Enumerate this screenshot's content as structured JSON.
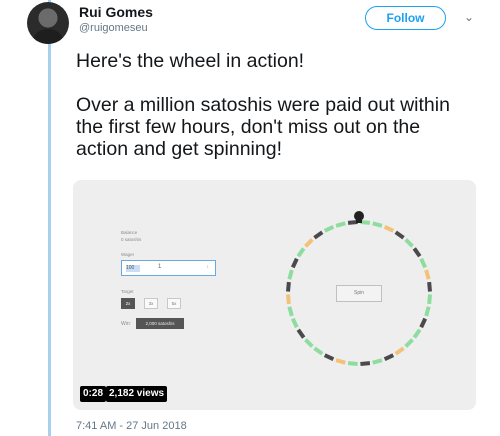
{
  "author": {
    "name": "Rui Gomes",
    "handle": "@ruigomeseu"
  },
  "follow_label": "Follow",
  "menu_icon": "chevron-down-icon",
  "tweet": {
    "paragraph_1": "Here's the wheel in action!",
    "paragraph_2": "Over a million satoshis were paid out within the first few hours, don't miss out on the action and get spinning!"
  },
  "video": {
    "duration": "0:28",
    "views": "2,182 views",
    "panel": {
      "balance_label": "Balance",
      "balance_value": "0 satoshis",
      "wager_label": "Wager",
      "wager_value": "1",
      "wager_selected": "100",
      "target_label": "Target",
      "targets": [
        "2x",
        "3x",
        "5x"
      ],
      "win_label": "Win:",
      "win_value": "2,000 satoshis"
    },
    "spin_label": "Spin"
  },
  "timestamp": "7:41 AM - 27 Jun 2018",
  "colors": {
    "accent": "#1da1f2",
    "thread_line": "#a6d0ec",
    "wheel_green": "#8fdc9f",
    "wheel_orange": "#f3c27a",
    "wheel_dark": "#4a4a4a"
  }
}
